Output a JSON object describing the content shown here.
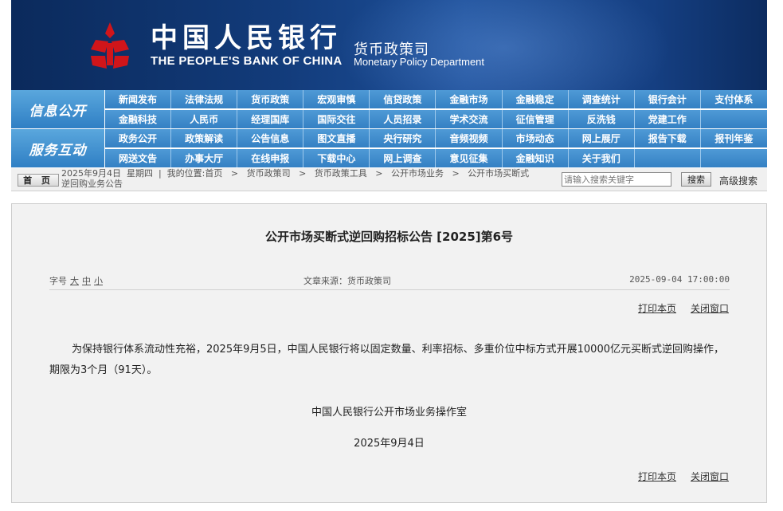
{
  "banner": {
    "bank_name_cn": "中国人民银行",
    "bank_name_en": "THE PEOPLE'S BANK OF CHINA",
    "dept_cn": "货币政策司",
    "dept_en": "Monetary Policy Department",
    "logo_icon": "pboc-logo-icon"
  },
  "nav": {
    "section1": {
      "label": "信息公开",
      "row1": [
        "新闻发布",
        "法律法规",
        "货币政策",
        "宏观审慎",
        "信贷政策",
        "金融市场",
        "金融稳定",
        "调查统计",
        "银行会计",
        "支付体系"
      ],
      "row2": [
        "金融科技",
        "人民币",
        "经理国库",
        "国际交往",
        "人员招录",
        "学术交流",
        "征信管理",
        "反洗钱",
        "党建工作",
        ""
      ]
    },
    "section2": {
      "label": "服务互动",
      "row1": [
        "政务公开",
        "政策解读",
        "公告信息",
        "图文直播",
        "央行研究",
        "音频视频",
        "市场动态",
        "网上展厅",
        "报告下载",
        "报刊年鉴"
      ],
      "row2": [
        "网送文告",
        "办事大厅",
        "在线申报",
        "下载中心",
        "网上调查",
        "意见征集",
        "金融知识",
        "关于我们",
        "",
        ""
      ]
    }
  },
  "breadcrumb": {
    "home_label": "首 页",
    "date_line": "2025年9月4日  星期四  |  我的位置:首页   >   货币政策司   >   货币政策工具   >   公开市场业务   >   公开市场买断式",
    "line2": "逆回购业务公告",
    "search_placeholder": "请输入搜索关键字",
    "search_button": "搜索",
    "advanced_search": "高级搜索"
  },
  "article": {
    "title": "公开市场买断式逆回购招标公告 [2025]第6号",
    "font_label": "字号",
    "font_large": "大",
    "font_medium": "中",
    "font_small": "小",
    "source": "文章来源：货币政策司",
    "date": "2025-09-04 17:00:00",
    "print": "打印本页",
    "close": "关闭窗口",
    "body": "为保持银行体系流动性充裕，2025年9月5日，中国人民银行将以固定数量、利率招标、多重价位中标方式开展10000亿元买断式逆回购操作，期限为3个月（91天）。",
    "signature": "中国人民银行公开市场业务操作室",
    "sign_date": "2025年9月4日"
  },
  "colors": {
    "banner_dark": "#0b2a5c",
    "nav_blue": "#3480c3",
    "logo_red": "#d0151a"
  }
}
